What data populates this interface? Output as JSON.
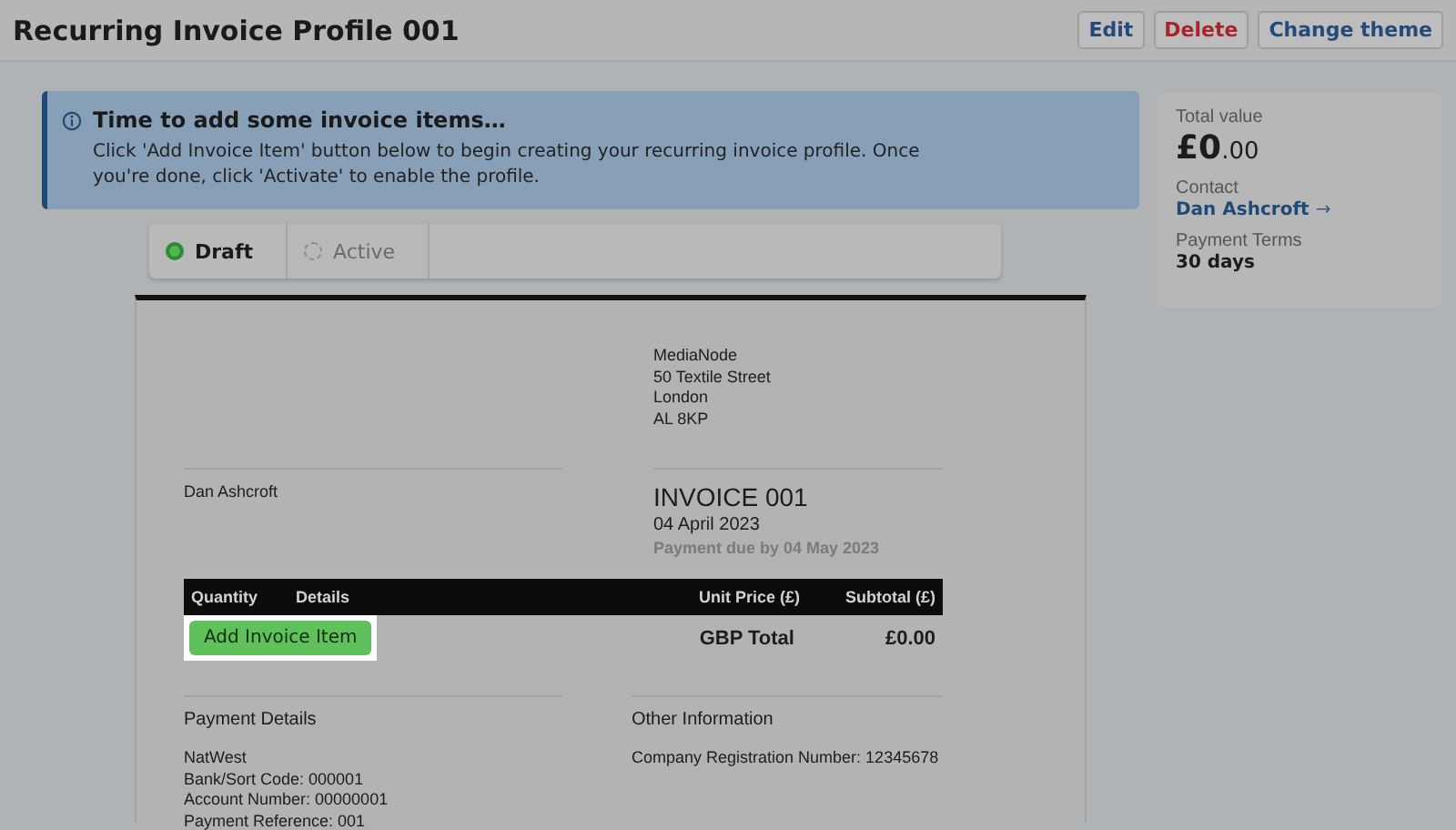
{
  "header": {
    "title": "Recurring Invoice Profile 001",
    "buttons": [
      {
        "label": "Edit",
        "kind": "primary"
      },
      {
        "label": "Delete",
        "kind": "danger"
      },
      {
        "label": "Change theme",
        "kind": "primary"
      }
    ]
  },
  "banner": {
    "title": "Time to add some invoice items…",
    "text": "Click 'Add Invoice Item' button below to begin creating your recurring invoice profile. Once you're done, click 'Activate' to enable the profile."
  },
  "steps": [
    {
      "label": "Draft",
      "selected": true
    },
    {
      "label": "Active",
      "selected": false
    }
  ],
  "invoice": {
    "company_address": [
      "MediaNode",
      "50 Textile Street",
      "London",
      "AL 8KP"
    ],
    "client": "Dan Ashcroft",
    "title": "INVOICE 001",
    "date": "04 April 2023",
    "due": "Payment due by 04 May 2023",
    "columns": [
      "Quantity",
      "Details",
      "Unit Price (£)",
      "Subtotal (£)"
    ],
    "add_button": "Add Invoice Item",
    "total_label": "GBP Total",
    "total_value": "£0.00",
    "payment_heading": "Payment Details",
    "payment_lines": [
      "NatWest",
      "Bank/Sort Code: 000001",
      "Account Number: 00000001",
      "Payment Reference: 001"
    ],
    "other_heading": "Other Information",
    "other_lines": [
      "Company Registration Number: 12345678"
    ]
  },
  "summary": {
    "total_label": "Total value",
    "total_main": "£0",
    "total_cents": ".00",
    "contact_label": "Contact",
    "contact_name": "Dan Ashcroft",
    "contact_arrow": "→",
    "terms_label": "Payment Terms",
    "terms_value": "30 days"
  }
}
